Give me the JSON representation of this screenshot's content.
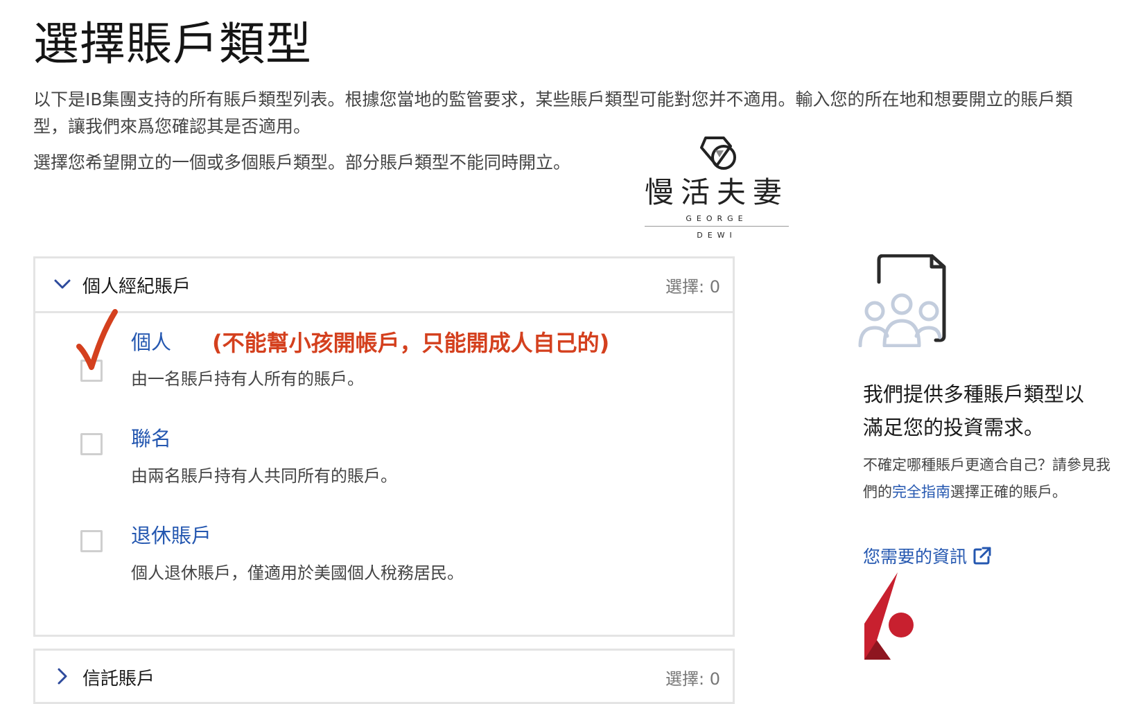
{
  "page": {
    "title": "選擇賬戶類型",
    "intro": "以下是IB集團支持的所有賬戶類型列表。根據您當地的監管要求，某些賬戶類型可能對您并不適用。輸入您的所在地和想要開立的賬戶類型，讓我們來爲您確認其是否適用。",
    "instruction": "選擇您希望開立的一個或多個賬戶類型。部分賬戶類型不能同時開立。"
  },
  "watermark": {
    "chinese": "慢活夫妻",
    "line1": "GEORGE",
    "line2": "DEWI"
  },
  "panels": [
    {
      "title": "個人經紀賬戶",
      "count_label": "選擇: 0",
      "expanded": true,
      "items": [
        {
          "label": "個人",
          "description": "由一名賬戶持有人所有的賬戶。",
          "checked": false
        },
        {
          "label": "聯名",
          "description": "由兩名賬戶持有人共同所有的賬戶。",
          "checked": false
        },
        {
          "label": "退休賬戶",
          "description": "個人退休賬戶，僅適用於美國個人稅務居民。",
          "checked": false
        }
      ]
    },
    {
      "title": "信託賬戶",
      "count_label": "選擇: 0",
      "expanded": false
    }
  ],
  "annotation": {
    "note": "(不能幫小孩開帳戶，只能開成人自己的)",
    "color": "#d4401e"
  },
  "sidebar": {
    "heading": "我們提供多種賬戶類型以滿足您的投資需求。",
    "text_before": "不確定哪種賬戶更適合自己？請參見我們的",
    "guide_link": "完全指南",
    "text_after": "選擇正確的賬戶。",
    "info_link": "您需要的資訊"
  },
  "colors": {
    "accent": "#2457b0",
    "chevron": "#2d4a9c",
    "logo_red": "#c8202f"
  }
}
